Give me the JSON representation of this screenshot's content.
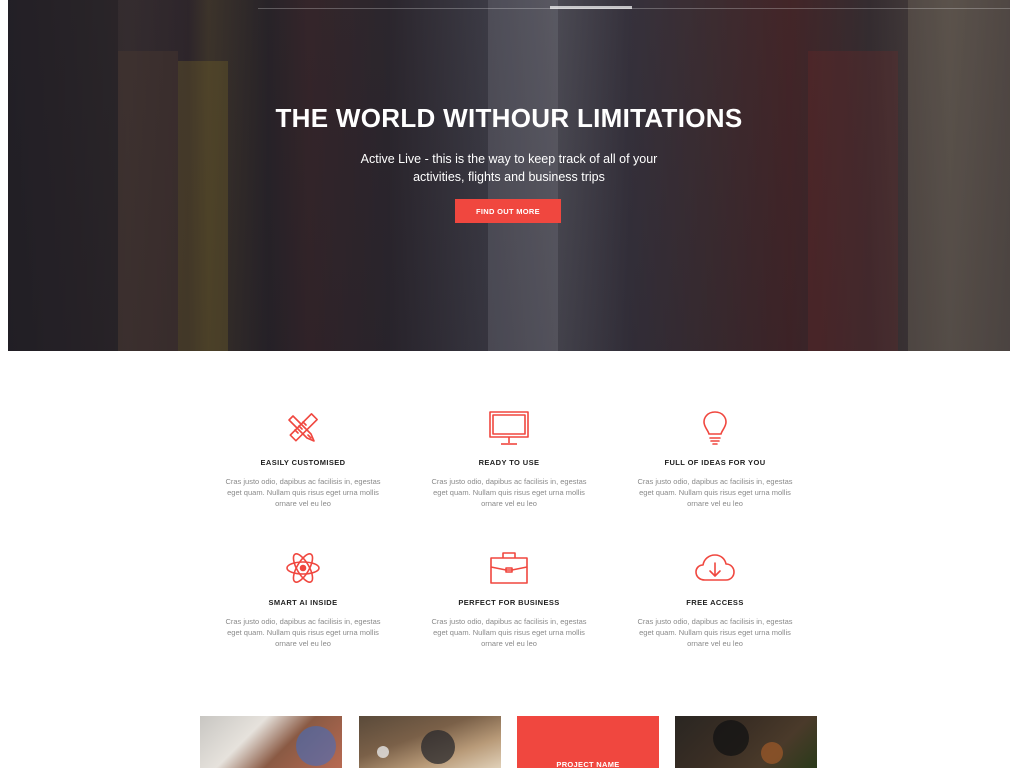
{
  "hero": {
    "title": "THE WORLD WITHOUR LIMITATIONS",
    "subtitle": "Active Live - this is the way to keep track of all of your activities, flights and business trips",
    "button_label": "FIND OUT MORE"
  },
  "colors": {
    "accent": "#f0473f",
    "heading": "#222222",
    "body_text": "#8a8a8a"
  },
  "features": [
    {
      "icon": "pencil-ruler-icon",
      "title": "EASILY CUSTOMISED",
      "text": "Cras justo odio, dapibus ac facilisis in, egestas eget quam. Nullam quis risus eget urna mollis ornare vel eu leo"
    },
    {
      "icon": "monitor-icon",
      "title": "READY TO USE",
      "text": "Cras justo odio, dapibus ac facilisis in, egestas eget quam. Nullam quis risus eget urna mollis ornare vel eu leo"
    },
    {
      "icon": "lightbulb-icon",
      "title": "FULL OF IDEAS FOR YOU",
      "text": "Cras justo odio, dapibus ac facilisis in, egestas eget quam. Nullam quis risus eget urna mollis ornare vel eu leo"
    },
    {
      "icon": "atom-icon",
      "title": "SMART AI INSIDE",
      "text": "Cras justo odio, dapibus ac facilisis in, egestas eget quam. Nullam quis risus eget urna mollis ornare vel eu leo"
    },
    {
      "icon": "briefcase-icon",
      "title": "PERFECT FOR BUSINESS",
      "text": "Cras justo odio, dapibus ac facilisis in, egestas eget quam. Nullam quis risus eget urna mollis ornare vel eu leo"
    },
    {
      "icon": "cloud-download-icon",
      "title": "FREE ACCESS",
      "text": "Cras justo odio, dapibus ac facilisis in, egestas eget quam. Nullam quis risus eget urna mollis ornare vel eu leo"
    }
  ],
  "projects": {
    "highlight_label": "PROJECT NAME"
  }
}
